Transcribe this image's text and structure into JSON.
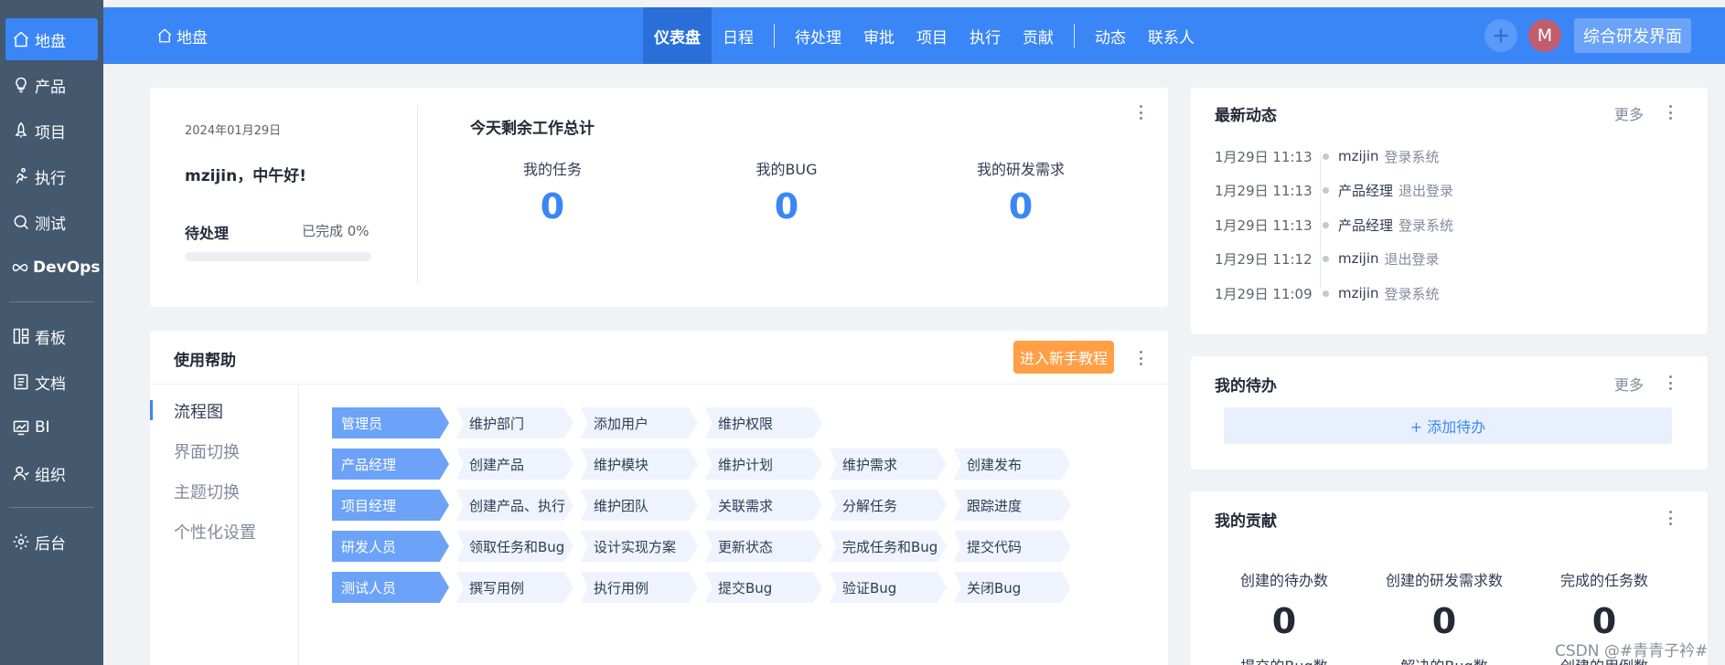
{
  "sidebar": {
    "items": [
      {
        "label": "地盘",
        "icon": "home-icon"
      },
      {
        "label": "产品",
        "icon": "lightbulb-icon"
      },
      {
        "label": "项目",
        "icon": "rocket-icon"
      },
      {
        "label": "执行",
        "icon": "run-icon"
      },
      {
        "label": "测试",
        "icon": "magnifier-icon"
      },
      {
        "label": "DevOps",
        "icon": "infinity-icon"
      },
      {
        "label": "看板",
        "icon": "kanban-icon"
      },
      {
        "label": "文档",
        "icon": "document-icon"
      },
      {
        "label": "BI",
        "icon": "monitor-chart-icon"
      },
      {
        "label": "组织",
        "icon": "people-icon"
      },
      {
        "label": "后台",
        "icon": "gear-icon"
      }
    ]
  },
  "header": {
    "home_label": "地盘",
    "nav": [
      "仪表盘",
      "日程",
      "待处理",
      "审批",
      "项目",
      "执行",
      "贡献",
      "动态",
      "联系人"
    ],
    "avatar_letter": "M",
    "switch_label": "综合研发界面",
    "accent_color": "#3b86f7"
  },
  "dashboard": {
    "date": "2024年01月29日",
    "greeting": "mzijin，中午好!",
    "pending_label": "待处理",
    "done_label": "已完成 0%",
    "progress_percent": 0,
    "title": "今天剩余工作总计",
    "stats": [
      {
        "label": "我的任务",
        "value": "0"
      },
      {
        "label": "我的BUG",
        "value": "0"
      },
      {
        "label": "我的研发需求",
        "value": "0"
      }
    ]
  },
  "help": {
    "title": "使用帮助",
    "tutorial_button": "进入新手教程",
    "menu": [
      "流程图",
      "界面切换",
      "主题切换",
      "个性化设置"
    ],
    "flow": [
      {
        "role": "管理员",
        "steps": [
          "维护部门",
          "添加用户",
          "维护权限"
        ]
      },
      {
        "role": "产品经理",
        "steps": [
          "创建产品",
          "维护模块",
          "维护计划",
          "维护需求",
          "创建发布"
        ]
      },
      {
        "role": "项目经理",
        "steps": [
          "创建产品、执行",
          "维护团队",
          "关联需求",
          "分解任务",
          "跟踪进度"
        ]
      },
      {
        "role": "研发人员",
        "steps": [
          "领取任务和Bug",
          "设计实现方案",
          "更新状态",
          "完成任务和Bug",
          "提交代码"
        ]
      },
      {
        "role": "测试人员",
        "steps": [
          "撰写用例",
          "执行用例",
          "提交Bug",
          "验证Bug",
          "关闭Bug"
        ]
      }
    ]
  },
  "activity": {
    "title": "最新动态",
    "more": "更多",
    "items": [
      {
        "time": "1月29日 11:13",
        "user": "mzijin",
        "action": "登录系统"
      },
      {
        "time": "1月29日 11:13",
        "user": "产品经理",
        "action": "退出登录"
      },
      {
        "time": "1月29日 11:13",
        "user": "产品经理",
        "action": "登录系统"
      },
      {
        "time": "1月29日 11:12",
        "user": "mzijin",
        "action": "退出登录"
      },
      {
        "time": "1月29日 11:09",
        "user": "mzijin",
        "action": "登录系统"
      }
    ]
  },
  "todo": {
    "title": "我的待办",
    "more": "更多",
    "add_label": "+ 添加待办"
  },
  "contribution": {
    "title": "我的贡献",
    "stats": [
      {
        "label": "创建的待办数",
        "value": "0",
        "next_label": "提交的Bug数"
      },
      {
        "label": "创建的研发需求数",
        "value": "0",
        "next_label": "解决的Bug数"
      },
      {
        "label": "完成的任务数",
        "value": "0",
        "next_label": "创建的用例数"
      }
    ]
  },
  "watermark": "CSDN @#青青子衿#"
}
